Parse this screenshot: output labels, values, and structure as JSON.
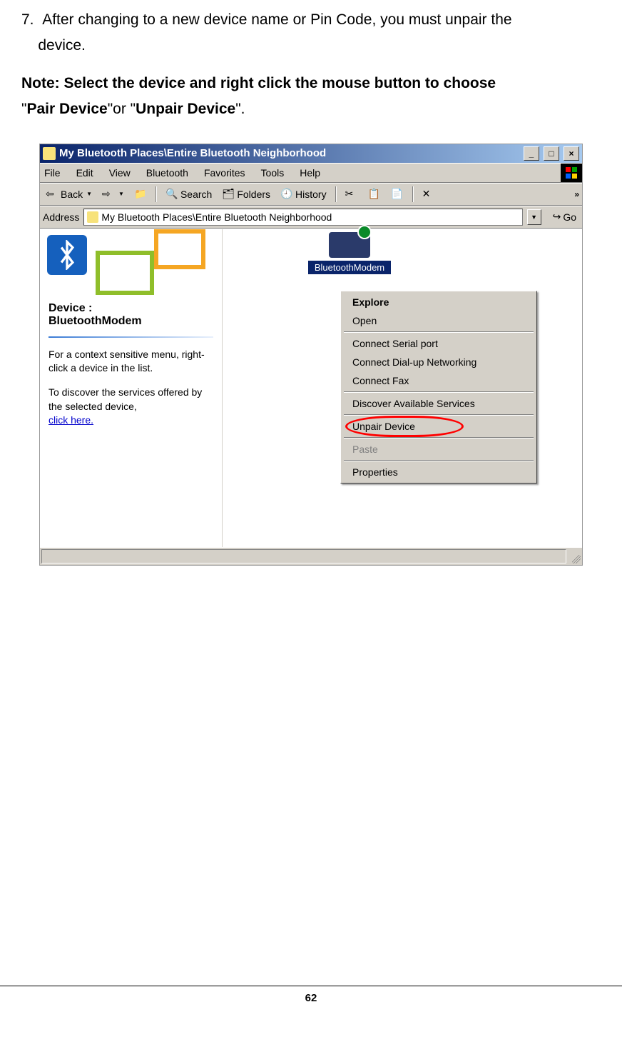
{
  "instruction": {
    "number": "7.",
    "text_a": "After changing to a new device name or Pin Code, you must unpair the",
    "text_b": "device."
  },
  "note": {
    "prefix": "Note: Select the device and right click the mouse button to choose",
    "q1": "\"",
    "pair": "Pair Device",
    "mid": "\"or \"",
    "unpair": "Unpair Device",
    "end": "\"."
  },
  "window": {
    "title": "My Bluetooth Places\\Entire Bluetooth Neighborhood",
    "min": "_",
    "max": "□",
    "close": "×"
  },
  "menu": {
    "file": "File",
    "edit": "Edit",
    "view": "View",
    "bluetooth": "Bluetooth",
    "favorites": "Favorites",
    "tools": "Tools",
    "help": "Help"
  },
  "toolbar": {
    "back": "Back",
    "search": "Search",
    "folders": "Folders",
    "history": "History",
    "more": "»"
  },
  "address": {
    "label": "Address",
    "value": "My Bluetooth Places\\Entire Bluetooth Neighborhood",
    "go": "Go"
  },
  "leftpane": {
    "device_label": "Device :",
    "device_name": "BluetoothModem",
    "help1": "For a context sensitive menu, right-click a device in the list.",
    "help2": "To discover the services offered by the selected device,",
    "link": "click here."
  },
  "device": {
    "label": "BluetoothModem"
  },
  "contextmenu": {
    "explore": "Explore",
    "open": "Open",
    "connect_serial": "Connect Serial port",
    "connect_dialup": "Connect Dial-up Networking",
    "connect_fax": "Connect Fax",
    "discover": "Discover Available Services",
    "unpair": "Unpair Device",
    "paste": "Paste",
    "properties": "Properties"
  },
  "page_number": "62"
}
